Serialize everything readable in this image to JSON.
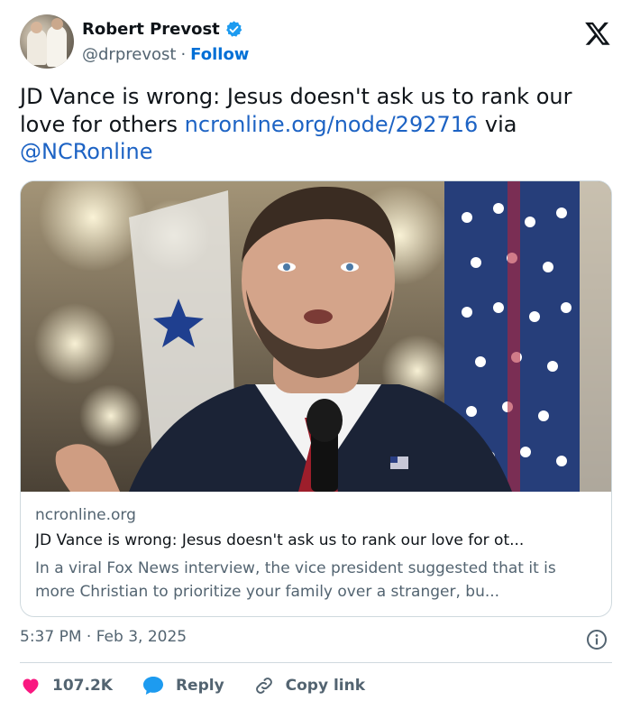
{
  "author": {
    "name": "Robert Prevost",
    "handle": "@drprevost",
    "separator": "·",
    "follow_label": "Follow"
  },
  "tweet": {
    "text_start": "JD Vance is wrong: Jesus doesn't ask us to rank our love for others ",
    "link_url_text": "ncronline.org/node/292716",
    "text_mid": " via ",
    "mention": "@NCRonline"
  },
  "card": {
    "domain": "ncronline.org",
    "title": "JD Vance is wrong: Jesus doesn't ask us to rank our love for ot...",
    "description": "In a viral Fox News interview, the vice president suggested that it is more Christian to prioritize your family over a stranger, bu..."
  },
  "meta": {
    "time": "5:37 PM · Feb 3, 2025"
  },
  "actions": {
    "likes": "107.2K",
    "reply_label": "Reply",
    "copy_label": "Copy link"
  },
  "colors": {
    "accent": "#1d9bf0",
    "link": "#1d63c4",
    "like": "#f91880"
  },
  "icons": [
    "verified-badge-icon",
    "x-logo-icon",
    "info-icon",
    "heart-icon",
    "reply-bubble-icon",
    "link-icon"
  ]
}
